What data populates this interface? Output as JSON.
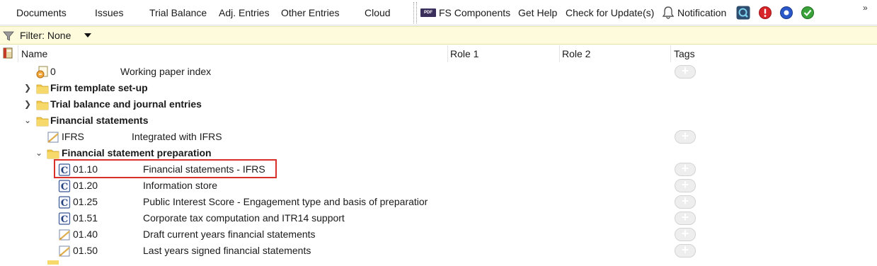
{
  "toolbar": {
    "documents": "Documents",
    "issues": "Issues",
    "trial_balance": "Trial Balance",
    "adj_entries": "Adj. Entries",
    "other_entries": "Other Entries",
    "cloud": "Cloud",
    "pdf_badge": "PDF",
    "fs_components": "FS Components",
    "get_help": "Get Help",
    "check_updates": "Check for Update(s)",
    "notification": "Notification",
    "more": "»"
  },
  "filter": {
    "label": "Filter: None"
  },
  "columns": {
    "name": "Name",
    "role1": "Role 1",
    "role2": "Role 2",
    "tags": "Tags"
  },
  "tree": {
    "r0": {
      "code": "0",
      "title": "Working paper index"
    },
    "r1": {
      "title": "Firm template set-up"
    },
    "r2": {
      "title": "Trial balance and journal entries"
    },
    "r3": {
      "title": "Financial statements"
    },
    "r4": {
      "code": "IFRS",
      "title": "Integrated with IFRS"
    },
    "r5": {
      "title": "Financial statement preparation"
    },
    "r6": {
      "code": "01.10",
      "title": "Financial statements - IFRS"
    },
    "r7": {
      "code": "01.20",
      "title": "Information store"
    },
    "r8": {
      "code": "01.25",
      "title": "Public Interest Score - Engagement type and basis of preparatior"
    },
    "r9": {
      "code": "01.51",
      "title": "Corporate tax computation and ITR14 support"
    },
    "r10": {
      "code": "01.40",
      "title": "Draft current years financial statements"
    },
    "r11": {
      "code": "01.50",
      "title": "Last years signed financial statements"
    }
  },
  "tag_button": "+",
  "colors": {
    "filter_bg": "#fdfbdc",
    "highlight": "#d9302b",
    "folder": "#f2c94c"
  }
}
